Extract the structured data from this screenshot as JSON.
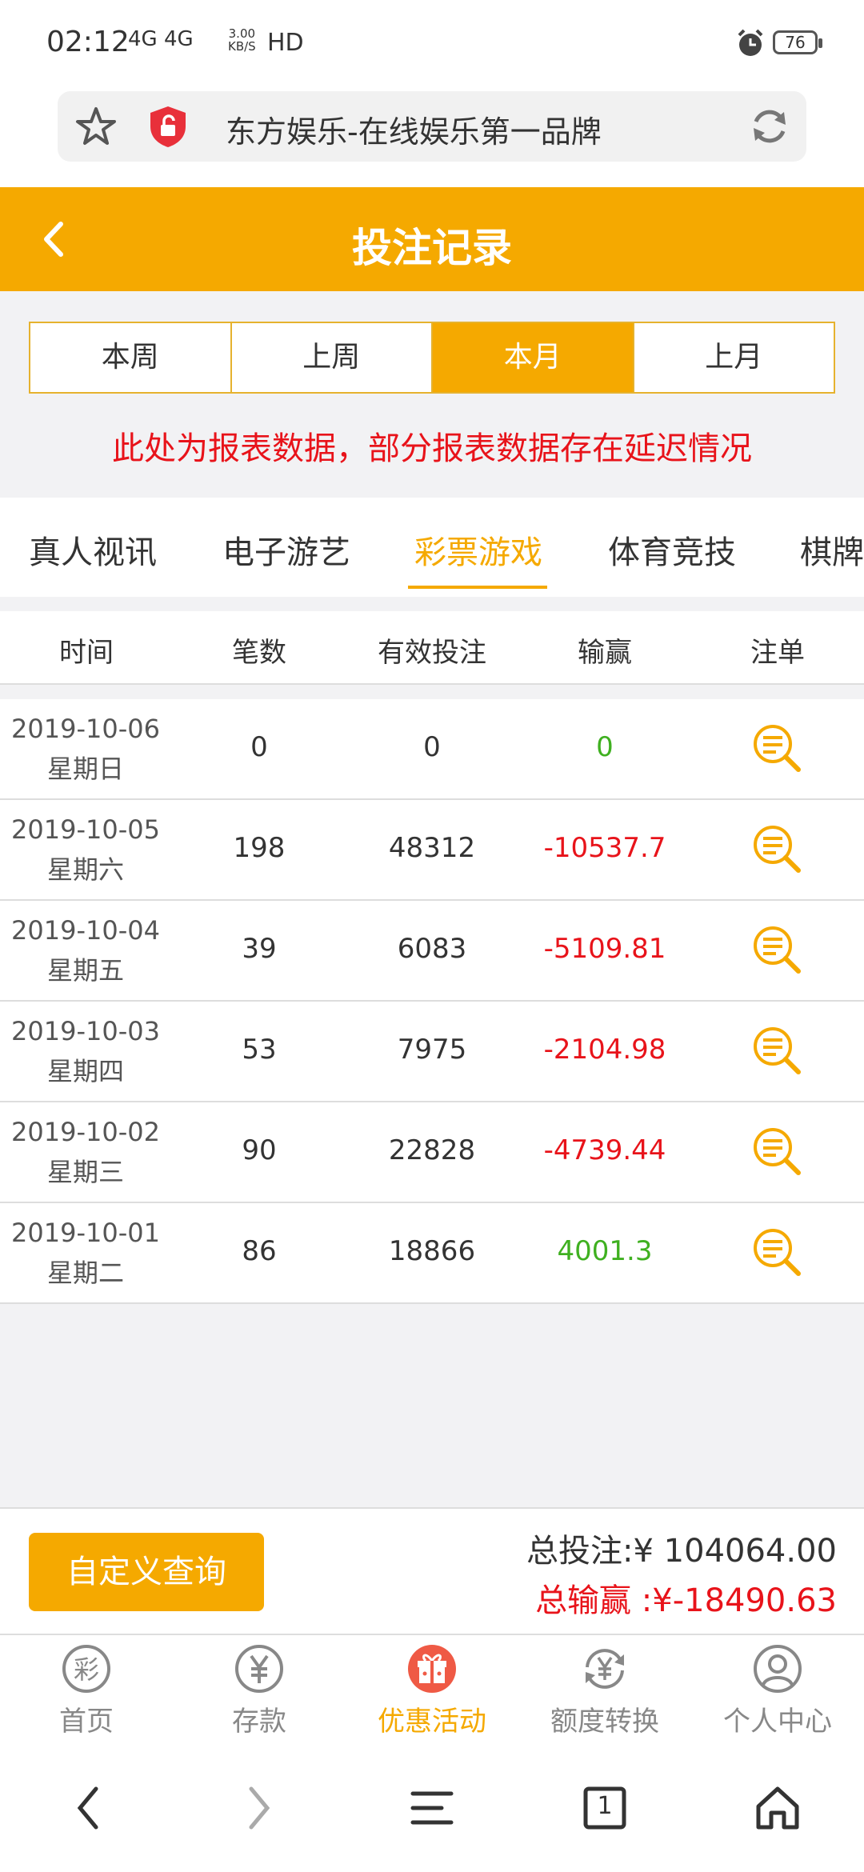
{
  "status": {
    "time": "02:12",
    "network": "4G 4G",
    "speed": "3.00\nKB/S",
    "hd": "HD",
    "battery": "76"
  },
  "browser": {
    "url_title": "东方娱乐-在线娱乐第一品牌"
  },
  "header": {
    "title": "投注记录"
  },
  "periods": [
    {
      "label": "本周",
      "active": false
    },
    {
      "label": "上周",
      "active": false
    },
    {
      "label": "本月",
      "active": true
    },
    {
      "label": "上月",
      "active": false
    }
  ],
  "notice": "此处为报表数据，部分报表数据存在延迟情况",
  "categories": [
    "真人视讯",
    "电子游艺",
    "彩票游戏",
    "体育竞技",
    "棋牌"
  ],
  "active_category": "彩票游戏",
  "table": {
    "headers": [
      "时间",
      "笔数",
      "有效投注",
      "输赢",
      "注单"
    ],
    "rows": [
      {
        "date": "2019-10-06",
        "weekday": "星期日",
        "count": "0",
        "bet": "0",
        "win": "0"
      },
      {
        "date": "2019-10-05",
        "weekday": "星期六",
        "count": "198",
        "bet": "48312",
        "win": "-10537.7"
      },
      {
        "date": "2019-10-04",
        "weekday": "星期五",
        "count": "39",
        "bet": "6083",
        "win": "-5109.81"
      },
      {
        "date": "2019-10-03",
        "weekday": "星期四",
        "count": "53",
        "bet": "7975",
        "win": "-2104.98"
      },
      {
        "date": "2019-10-02",
        "weekday": "星期三",
        "count": "90",
        "bet": "22828",
        "win": "-4739.44"
      },
      {
        "date": "2019-10-01",
        "weekday": "星期二",
        "count": "86",
        "bet": "18866",
        "win": "4001.3"
      }
    ]
  },
  "summary": {
    "query_button": "自定义查询",
    "total_bet": "总投注:¥ 104064.00",
    "total_win": "总输赢 :¥-18490.63"
  },
  "tabbar": [
    {
      "label": "首页",
      "icon": "lottery-icon",
      "active": false
    },
    {
      "label": "存款",
      "icon": "yen-icon",
      "active": false
    },
    {
      "label": "优惠活动",
      "icon": "gift-icon",
      "active": true
    },
    {
      "label": "额度转换",
      "icon": "exchange-icon",
      "active": false
    },
    {
      "label": "个人中心",
      "icon": "user-icon",
      "active": false
    }
  ],
  "nav": {
    "tab_count": "1"
  },
  "colors": {
    "accent": "#f5a900",
    "loss": "#e8131a",
    "gain": "#3fb020"
  }
}
